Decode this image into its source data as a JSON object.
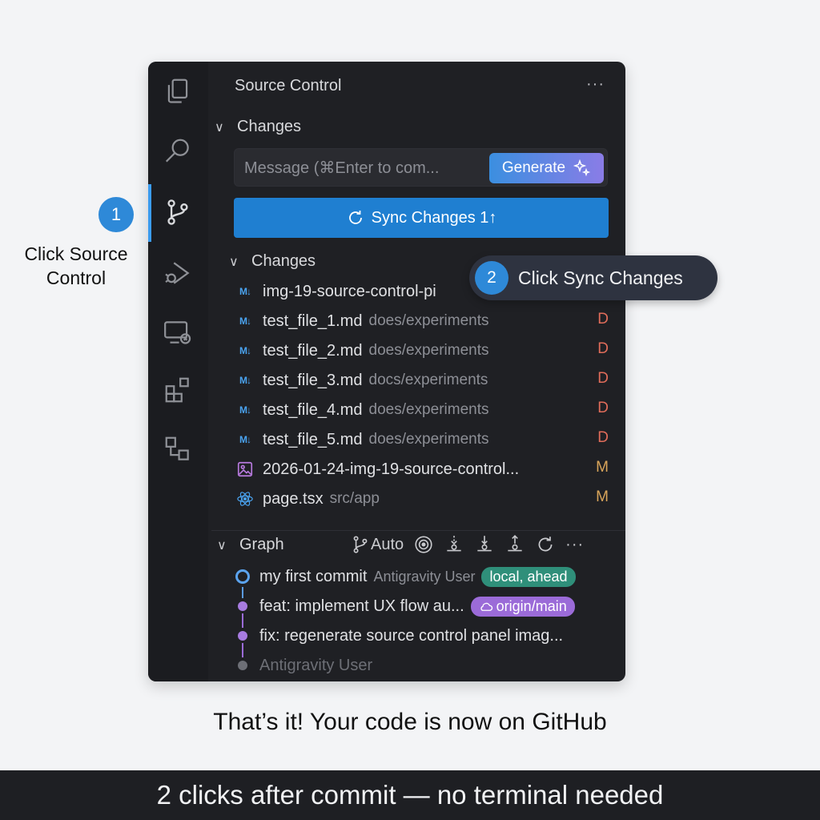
{
  "callouts": {
    "step1_number": "1",
    "step1_text": "Click Source Control",
    "step2_number": "2",
    "step2_text": "Click Sync Changes"
  },
  "sidebar": {
    "title": "Source Control",
    "more": "···",
    "changes_section": "Changes",
    "message_placeholder": "Message (⌘Enter to com...",
    "generate_label": "Generate",
    "sync_label": "Sync Changes 1↑",
    "changes_subsection": "Changes",
    "files": [
      {
        "name": "img-19-source-control-pi",
        "path": "",
        "status": "",
        "type": "md"
      },
      {
        "name": "test_file_1.md",
        "path": "does/experiments",
        "status": "D",
        "type": "md"
      },
      {
        "name": "test_file_2.md",
        "path": "does/experiments",
        "status": "D",
        "type": "md"
      },
      {
        "name": "test_file_3.md",
        "path": "docs/experiments",
        "status": "D",
        "type": "md"
      },
      {
        "name": "test_file_4.md",
        "path": "does/experiments",
        "status": "D",
        "type": "md"
      },
      {
        "name": "test_file_5.md",
        "path": "does/experiments",
        "status": "D",
        "type": "md"
      },
      {
        "name": "2026-01-24-img-19-source-control...",
        "path": "",
        "status": "M",
        "type": "image"
      },
      {
        "name": "page.tsx",
        "path": "src/app",
        "status": "M",
        "type": "react"
      }
    ],
    "graph": {
      "label": "Graph",
      "auto_label": "Auto",
      "more": "···",
      "commits": [
        {
          "message": "my first commit",
          "author": "Antigravity User",
          "badge": "local, ahead",
          "badge_color": "#2f8f7a"
        },
        {
          "message": "feat: implement UX flow au...",
          "author": "",
          "badge": "origin/main",
          "badge_color": "#9b6bd8"
        },
        {
          "message": "fix: regenerate source control panel imag...",
          "author": "",
          "badge": "",
          "badge_color": ""
        },
        {
          "message": "Antigravity User",
          "author": "",
          "badge": "",
          "badge_color": ""
        }
      ]
    }
  },
  "activity_bar": [
    "explorer-icon",
    "search-icon",
    "source-control-icon",
    "run-debug-icon",
    "remote-explorer-icon",
    "extensions-icon",
    "workspaces-icon"
  ],
  "colors": {
    "accent": "#1f7fd1",
    "deleted": "#e06c5a",
    "modified": "#d9a55a"
  },
  "caption": "That’s it! Your code is now on GitHub",
  "footer": "2 clicks after commit — no terminal needed"
}
